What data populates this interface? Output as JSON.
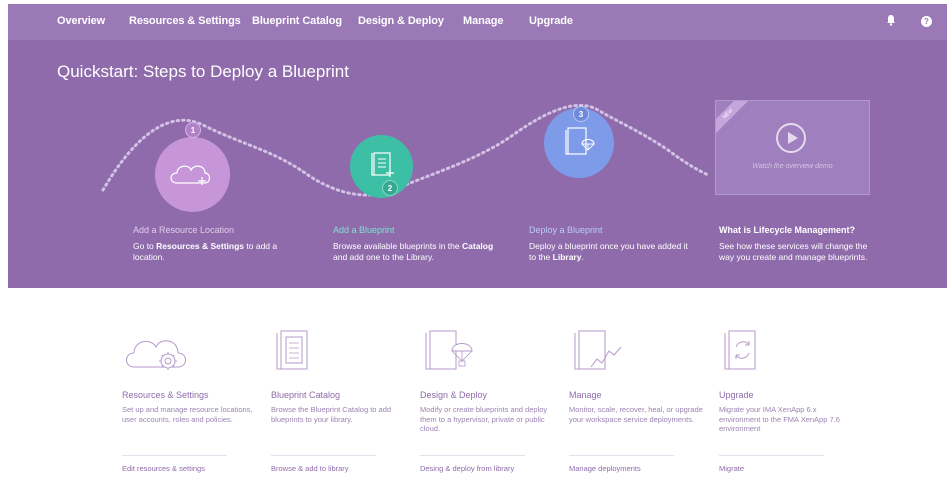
{
  "nav": {
    "items": [
      "Overview",
      "Resources & Settings",
      "Blueprint Catalog",
      "Design & Deploy",
      "Manage",
      "Upgrade"
    ],
    "bell_icon": "bell-icon",
    "help_icon": "help-icon"
  },
  "hero": {
    "title_prefix": "Quickstart",
    "title_rest": ": Steps to Deploy a Blueprint",
    "steps": [
      {
        "number": "1",
        "icon": "cloud-plus-icon",
        "heading": "Add a Resource Location",
        "text_before": "Go to ",
        "text_bold": "Resources & Settings",
        "text_after": " to add a location.",
        "color": "#c696d8"
      },
      {
        "number": "2",
        "icon": "blueprint-plus-icon",
        "heading": "Add a Blueprint",
        "text_before": "Browse available blueprints in the ",
        "text_bold": "Catalog",
        "text_after": " and add one to the Library.",
        "color": "#3dbfa6"
      },
      {
        "number": "3",
        "icon": "blueprint-parachute-icon",
        "heading": "Deploy a Blueprint",
        "text_before": "Deploy a blueprint once you have added it to the ",
        "text_bold": "Library",
        "text_after": ".",
        "color": "#7e9bea"
      }
    ],
    "video": {
      "ribbon": "NEW",
      "caption": "Watch the overview demo",
      "icon": "play-icon"
    },
    "lifecycle": {
      "heading": "What is Lifecycle Management?",
      "text": "See how these services will change the way you create and manage blueprints."
    }
  },
  "cards": [
    {
      "icon": "cloud-gear-icon",
      "title": "Resources & Settings",
      "desc": "Set up and manage resource locations, user accounts, roles and policies.",
      "link": "Edit resources & settings"
    },
    {
      "icon": "blueprint-book-icon",
      "title": "Blueprint Catalog",
      "desc": "Browse the Blueprint Catalog to add blueprints to your library.",
      "link": "Browse & add to library"
    },
    {
      "icon": "blueprint-parachute-icon",
      "title": "Design & Deploy",
      "desc": "Modify or create blueprints and deploy them to a hypervisor, private or public cloud.",
      "link": "Desing & deploy from library"
    },
    {
      "icon": "blueprint-chart-icon",
      "title": "Manage",
      "desc": "Monitor, scale, recover, heal, or upgrade your workspace service deployments.",
      "link": "Manage deployments"
    },
    {
      "icon": "blueprint-arrows-icon",
      "title": "Upgrade",
      "desc": "Migrate your IMA XenApp 6.x environment to the FMA XenApp 7.6 environment",
      "link": "Migrate"
    }
  ]
}
